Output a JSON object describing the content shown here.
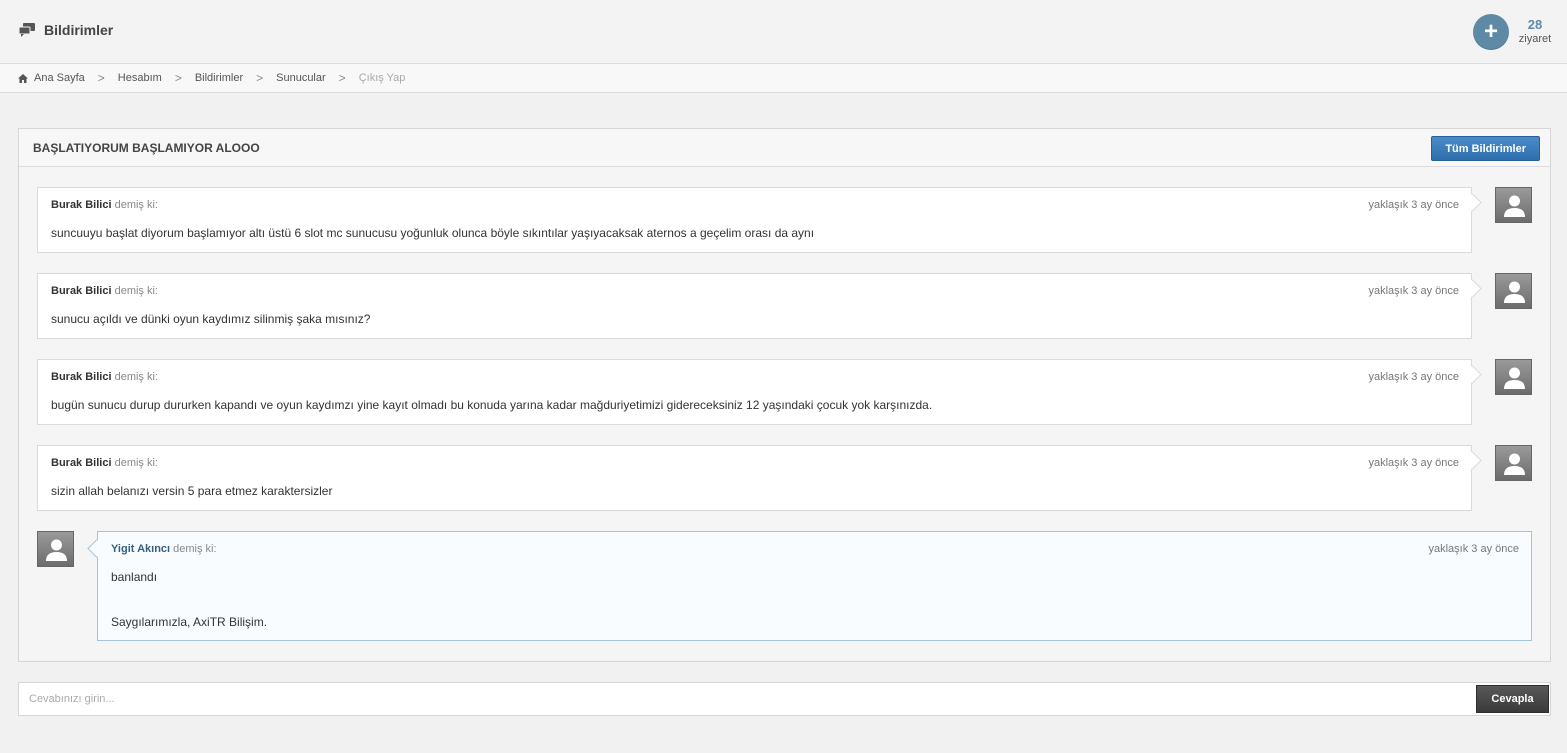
{
  "header": {
    "title": "Bildirimler",
    "visits_count": "28",
    "visits_label": "ziyaret",
    "add_icon": "plus-icon",
    "title_icon": "chat-bubbles-icon"
  },
  "breadcrumb": [
    {
      "label": "Ana Sayfa",
      "icon": "home-icon"
    },
    {
      "label": "Hesabım"
    },
    {
      "label": "Bildirimler"
    },
    {
      "label": "Sunucular"
    },
    {
      "label": "Çıkış Yap"
    }
  ],
  "ticket": {
    "title": "BAŞLATIYORUM BAŞLAMIYOR ALOOO",
    "all_button": "Tüm Bildirimler"
  },
  "messages": [
    {
      "author": "Burak Bilici",
      "said": "demiş ki:",
      "time": "yaklaşık 3 ay önce",
      "text": "suncuuyu başlat diyorum başlamıyor altı üstü 6 slot mc sunucusu yoğunluk olunca böyle sıkıntılar yaşıyacaksak aternos a geçelim orası da aynı"
    },
    {
      "author": "Burak Bilici",
      "said": "demiş ki:",
      "time": "yaklaşık 3 ay önce",
      "text": "sunucu açıldı ve dünki oyun kaydımız silinmiş şaka mısınız?"
    },
    {
      "author": "Burak Bilici",
      "said": "demiş ki:",
      "time": "yaklaşık 3 ay önce",
      "text": "bugün sunucu durup dururken kapandı ve oyun kaydımzı yine kayıt olmadı bu konuda yarına kadar mağduriyetimizi gidereceksiniz 12 yaşındaki çocuk yok karşınızda."
    },
    {
      "author": "Burak Bilici",
      "said": "demiş ki:",
      "time": "yaklaşık 3 ay önce",
      "text": "sizin allah belanızı versin 5 para etmez karaktersizler"
    },
    {
      "author": "Yigit Akıncı",
      "said": "demiş ki:",
      "time": "yaklaşık 3 ay önce",
      "text": "banlandı",
      "signature": "Saygılarımızla, AxiTR Bilişim."
    }
  ],
  "reply": {
    "placeholder": "Cevabınızı girin...",
    "button": "Cevapla"
  },
  "colors": {
    "accent": "#5e8aa6",
    "primary_button": "#3a7bbf",
    "dark_button": "#454545",
    "staff_border": "#9fc4dc"
  }
}
